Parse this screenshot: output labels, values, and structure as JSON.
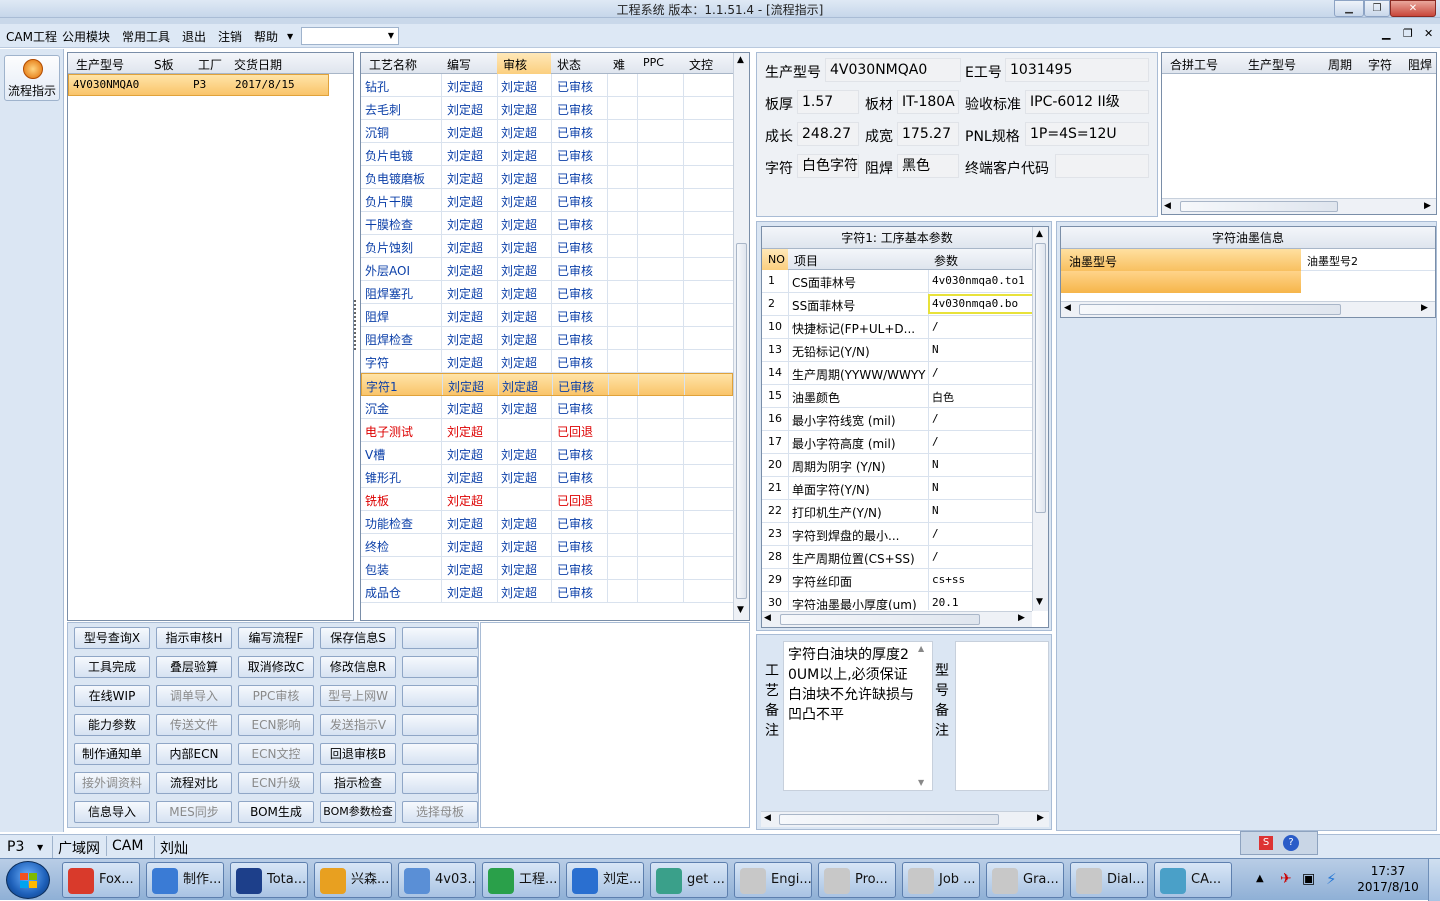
{
  "window": {
    "title": "工程系统   版本：1.1.51.4 - [流程指示]"
  },
  "menu": {
    "items": [
      "CAM工程",
      "公用模块",
      "常用工具",
      "退出",
      "注销",
      "帮助"
    ]
  },
  "sidebar": {
    "label": "流程指示"
  },
  "jobs": {
    "headers": [
      "生产型号",
      "S板",
      "工厂",
      "交货日期"
    ],
    "rows": [
      {
        "model": "4V030NMQA0",
        "sboard": "",
        "factory": "P3",
        "date": "2017/8/15"
      }
    ]
  },
  "process": {
    "headers": [
      "工艺名称",
      "编写",
      "审核",
      "状态",
      "难",
      "PPC",
      "文控"
    ],
    "rows": [
      {
        "name": "钻孔",
        "writer": "刘定超",
        "reviewer": "刘定超",
        "status": "已审核"
      },
      {
        "name": "去毛刺",
        "writer": "刘定超",
        "reviewer": "刘定超",
        "status": "已审核"
      },
      {
        "name": "沉铜",
        "writer": "刘定超",
        "reviewer": "刘定超",
        "status": "已审核"
      },
      {
        "name": "负片电镀",
        "writer": "刘定超",
        "reviewer": "刘定超",
        "status": "已审核"
      },
      {
        "name": "负电镀磨板",
        "writer": "刘定超",
        "reviewer": "刘定超",
        "status": "已审核"
      },
      {
        "name": "负片干膜",
        "writer": "刘定超",
        "reviewer": "刘定超",
        "status": "已审核"
      },
      {
        "name": "干膜检查",
        "writer": "刘定超",
        "reviewer": "刘定超",
        "status": "已审核"
      },
      {
        "name": "负片蚀刻",
        "writer": "刘定超",
        "reviewer": "刘定超",
        "status": "已审核"
      },
      {
        "name": "外层AOI",
        "writer": "刘定超",
        "reviewer": "刘定超",
        "status": "已审核"
      },
      {
        "name": "阻焊塞孔",
        "writer": "刘定超",
        "reviewer": "刘定超",
        "status": "已审核"
      },
      {
        "name": "阻焊",
        "writer": "刘定超",
        "reviewer": "刘定超",
        "status": "已审核"
      },
      {
        "name": "阻焊检查",
        "writer": "刘定超",
        "reviewer": "刘定超",
        "status": "已审核"
      },
      {
        "name": "字符",
        "writer": "刘定超",
        "reviewer": "刘定超",
        "status": "已审核"
      },
      {
        "name": "字符1",
        "writer": "刘定超",
        "reviewer": "刘定超",
        "status": "已审核",
        "selected": true
      },
      {
        "name": "沉金",
        "writer": "刘定超",
        "reviewer": "刘定超",
        "status": "已审核"
      },
      {
        "name": "电子测试",
        "writer": "刘定超",
        "reviewer": "",
        "status": "已回退",
        "returned": true
      },
      {
        "name": "V槽",
        "writer": "刘定超",
        "reviewer": "刘定超",
        "status": "已审核"
      },
      {
        "name": "锥形孔",
        "writer": "刘定超",
        "reviewer": "刘定超",
        "status": "已审核"
      },
      {
        "name": "铣板",
        "writer": "刘定超",
        "reviewer": "",
        "status": "已回退",
        "returned": true
      },
      {
        "name": "功能检查",
        "writer": "刘定超",
        "reviewer": "刘定超",
        "status": "已审核"
      },
      {
        "name": "终检",
        "writer": "刘定超",
        "reviewer": "刘定超",
        "status": "已审核"
      },
      {
        "name": "包装",
        "writer": "刘定超",
        "reviewer": "刘定超",
        "status": "已审核"
      },
      {
        "name": "成品仓",
        "writer": "刘定超",
        "reviewer": "刘定超",
        "status": "已审核"
      }
    ]
  },
  "buttons": [
    [
      {
        "label": "型号查询X",
        "enabled": true
      },
      {
        "label": "指示审核H",
        "enabled": true
      },
      {
        "label": "编写流程F",
        "enabled": true
      },
      {
        "label": "保存信息S",
        "enabled": true
      },
      {
        "label": "",
        "enabled": true
      }
    ],
    [
      {
        "label": "工具完成",
        "enabled": true
      },
      {
        "label": "叠层验算",
        "enabled": true
      },
      {
        "label": "取消修改C",
        "enabled": true
      },
      {
        "label": "修改信息R",
        "enabled": true
      },
      {
        "label": "",
        "enabled": true
      }
    ],
    [
      {
        "label": "在线WIP",
        "enabled": true
      },
      {
        "label": "调单导入",
        "enabled": false
      },
      {
        "label": "PPC审核",
        "enabled": false
      },
      {
        "label": "型号上网W",
        "enabled": false
      },
      {
        "label": "",
        "enabled": true
      }
    ],
    [
      {
        "label": "能力参数",
        "enabled": true
      },
      {
        "label": "传送文件",
        "enabled": false
      },
      {
        "label": "ECN影响",
        "enabled": false
      },
      {
        "label": "发送指示V",
        "enabled": false
      },
      {
        "label": "",
        "enabled": true
      }
    ],
    [
      {
        "label": "制作通知单",
        "enabled": true
      },
      {
        "label": "内部ECN",
        "enabled": true
      },
      {
        "label": "ECN文控",
        "enabled": false
      },
      {
        "label": "回退审核B",
        "enabled": true
      },
      {
        "label": "",
        "enabled": true
      }
    ],
    [
      {
        "label": "接外调资料",
        "enabled": false
      },
      {
        "label": "流程对比",
        "enabled": true
      },
      {
        "label": "ECN升级",
        "enabled": false
      },
      {
        "label": "指示检查",
        "enabled": true
      },
      {
        "label": "",
        "enabled": true
      }
    ],
    [
      {
        "label": "信息导入",
        "enabled": true
      },
      {
        "label": "MES同步",
        "enabled": false
      },
      {
        "label": "BOM生成",
        "enabled": true
      },
      {
        "label": "BOM参数检查",
        "enabled": true
      },
      {
        "label": "选择母板",
        "enabled": false
      }
    ]
  ],
  "info": {
    "model_label": "生产型号",
    "model": "4V030NMQA0",
    "eno_label": "E工号",
    "eno": "1031495",
    "thick_label": "板厚",
    "thick": "1.57",
    "mat_label": "板材",
    "mat": "IT-180A",
    "std_label": "验收标准",
    "std": "IPC-6012 II级",
    "len_label": "成长",
    "len": "248.27",
    "wid_label": "成宽",
    "wid": "175.27",
    "pnl_label": "PNL规格",
    "pnl": "1P=4S=12U",
    "char_label": "字符",
    "char": "白色字符",
    "mask_label": "阻焊",
    "mask": "黑色",
    "cust_label": "终端客户代码",
    "cust": ""
  },
  "merge": {
    "headers": [
      "合拼工号",
      "生产型号",
      "周期",
      "字符",
      "阻焊"
    ]
  },
  "params": {
    "title": "字符1: 工序基本参数",
    "headers": [
      "NO",
      "项目",
      "参数"
    ],
    "rows": [
      {
        "no": "1",
        "item": "CS面菲林号",
        "value": "4v030nmqa0.to1"
      },
      {
        "no": "2",
        "item": "SS面菲林号",
        "value": "4v030nmqa0.bo",
        "highlight": true
      },
      {
        "no": "10",
        "item": "快捷标记(FP+UL+D...",
        "value": "/"
      },
      {
        "no": "13",
        "item": "无铅标记(Y/N)",
        "value": "N"
      },
      {
        "no": "14",
        "item": "生产周期(YYWW/WWYY)",
        "value": "/"
      },
      {
        "no": "15",
        "item": "油墨颜色",
        "value": "白色"
      },
      {
        "no": "16",
        "item": "最小字符线宽 (mil)",
        "value": "/"
      },
      {
        "no": "17",
        "item": "最小字符高度 (mil)",
        "value": "/"
      },
      {
        "no": "20",
        "item": "周期为阴字 (Y/N)",
        "value": "N"
      },
      {
        "no": "21",
        "item": "单面字符(Y/N)",
        "value": "N"
      },
      {
        "no": "22",
        "item": "打印机生产(Y/N)",
        "value": "N"
      },
      {
        "no": "23",
        "item": "字符到焊盘的最小...",
        "value": "/"
      },
      {
        "no": "28",
        "item": "生产周期位置(CS+SS)",
        "value": "/"
      },
      {
        "no": "29",
        "item": "字符丝印面",
        "value": "cs+ss"
      },
      {
        "no": "30",
        "item": "字符油墨最小厚度(um)",
        "value": "20.1"
      }
    ]
  },
  "ink": {
    "title": "字符油墨信息",
    "headers": [
      "油墨型号",
      "油墨型号2"
    ]
  },
  "notes": {
    "process_label": "工艺备注",
    "process_text": "字符白油块的厚度20UM以上,必须保证白油块不允许缺损与凹凸不平",
    "model_label": "型号备注",
    "model_text": ""
  },
  "status": {
    "factory": "P3",
    "net": "广域网",
    "app": "CAM",
    "user": "刘灿"
  },
  "taskbar": {
    "items": [
      "Fox...",
      "制作...",
      "Tota...",
      "兴森...",
      "4v03...",
      "工程...",
      "刘定...",
      "get ...",
      "Engi...",
      "Pro...",
      "Job ...",
      "Gra...",
      "Dial...",
      "CA..."
    ],
    "time": "17:37",
    "date": "2017/8/10"
  }
}
